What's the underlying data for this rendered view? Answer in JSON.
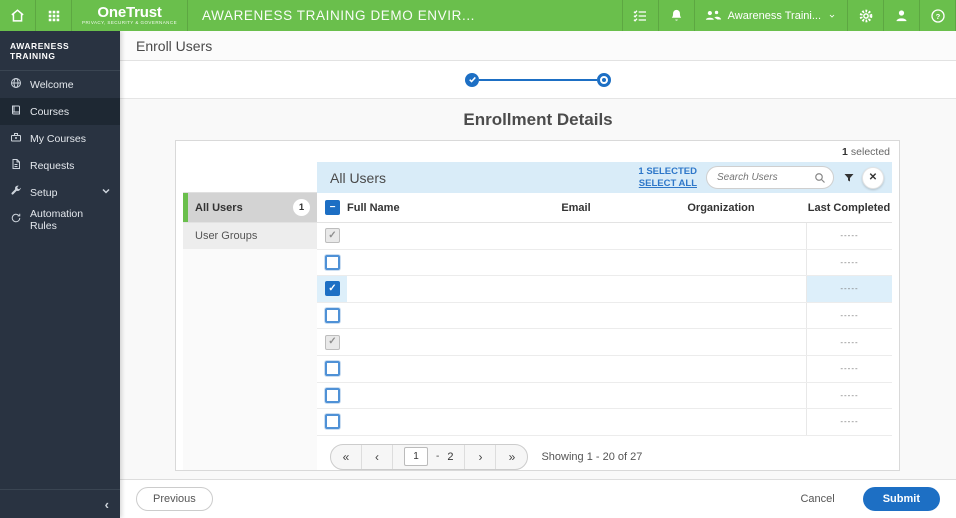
{
  "colors": {
    "brand_green": "#6abf4c",
    "accent_blue": "#1d6fc4",
    "table_header_bg": "#d9ecf8",
    "row_highlight": "#ddeffa",
    "sidebar_bg": "#293341"
  },
  "header": {
    "brand": "OneTrust",
    "brand_tagline": "PRIVACY, SECURITY & GOVERNANCE",
    "app_title": "AWARENESS TRAINING DEMO ENVIR...",
    "workspace_label": "Awareness Traini..."
  },
  "sidebar": {
    "title": "AWARENESS TRAINING",
    "items": [
      {
        "label": "Welcome"
      },
      {
        "label": "Courses"
      },
      {
        "label": "My Courses"
      },
      {
        "label": "Requests"
      },
      {
        "label": "Setup"
      },
      {
        "label": "Automation Rules"
      }
    ]
  },
  "page": {
    "title": "Enroll Users",
    "section_heading": "Enrollment Details"
  },
  "card": {
    "selected_count": "1",
    "selected_label": "selected"
  },
  "panel": {
    "groups": [
      {
        "label": "All Users",
        "badge": "1"
      },
      {
        "label": "User Groups"
      }
    ]
  },
  "table": {
    "title": "All Users",
    "selected_label": "1 SELECTED",
    "select_all_label": "SELECT ALL",
    "search_placeholder": "Search Users",
    "columns": [
      "Full Name",
      "Email",
      "Organization",
      "Last Completed"
    ],
    "rows": [
      {
        "state": "checked-disabled",
        "full_name": "",
        "email": "",
        "organization": "",
        "last_completed": "-----",
        "highlighted": false
      },
      {
        "state": "unchecked",
        "full_name": "",
        "email": "",
        "organization": "",
        "last_completed": "-----",
        "highlighted": false
      },
      {
        "state": "checked",
        "full_name": "",
        "email": "",
        "organization": "",
        "last_completed": "-----",
        "highlighted": true
      },
      {
        "state": "unchecked",
        "full_name": "",
        "email": "",
        "organization": "",
        "last_completed": "-----",
        "highlighted": false
      },
      {
        "state": "checked-disabled",
        "full_name": "",
        "email": "",
        "organization": "",
        "last_completed": "-----",
        "highlighted": false
      },
      {
        "state": "unchecked",
        "full_name": "",
        "email": "",
        "organization": "",
        "last_completed": "-----",
        "highlighted": false
      },
      {
        "state": "unchecked",
        "full_name": "",
        "email": "",
        "organization": "",
        "last_completed": "-----",
        "highlighted": false
      },
      {
        "state": "unchecked",
        "full_name": "",
        "email": "",
        "organization": "",
        "last_completed": "-----",
        "highlighted": false
      }
    ],
    "pagination": {
      "first_glyph": "«",
      "prev_glyph": "‹",
      "page_value": "1",
      "dash": "-",
      "total_pages": "2",
      "next_glyph": "›",
      "last_glyph": "»",
      "showing_text": "Showing 1 - 20 of 27"
    }
  },
  "footer": {
    "previous_label": "Previous",
    "cancel_label": "Cancel",
    "submit_label": "Submit"
  },
  "icons": {
    "check_glyph": "✓",
    "minus_glyph": "−",
    "clear_glyph": "✕",
    "collapse_glyph": "‹"
  }
}
